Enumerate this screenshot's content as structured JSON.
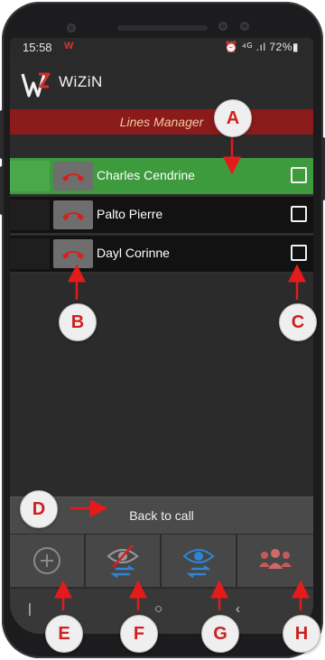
{
  "status_bar": {
    "time": "15:58",
    "indicators": "⏰ ⁴ᴳ .ıl 72%▮"
  },
  "app": {
    "name": "WiZiN"
  },
  "lines_manager": {
    "title": "Lines Manager"
  },
  "lines": [
    {
      "name": "Charles Cendrine",
      "active": true,
      "checked": false
    },
    {
      "name": "Palto Pierre",
      "active": false,
      "checked": false
    },
    {
      "name": "Dayl Corinne",
      "active": false,
      "checked": false
    }
  ],
  "back_to_call": {
    "label": "Back to call"
  },
  "toolbar": {
    "buttons": [
      {
        "icon": "add-circle-icon"
      },
      {
        "icon": "eye-slash-transfer-icon"
      },
      {
        "icon": "eye-transfer-icon"
      },
      {
        "icon": "group-icon"
      }
    ]
  },
  "callouts": {
    "a": "A",
    "b": "B",
    "c": "C",
    "d": "D",
    "e": "E",
    "f": "F",
    "g": "G",
    "h": "H"
  },
  "colors": {
    "active_row": "#3d9b3d",
    "lines_bar": "#8b1a1a",
    "callout_text": "#cf1f1f",
    "brand_red": "#d32f2f"
  }
}
